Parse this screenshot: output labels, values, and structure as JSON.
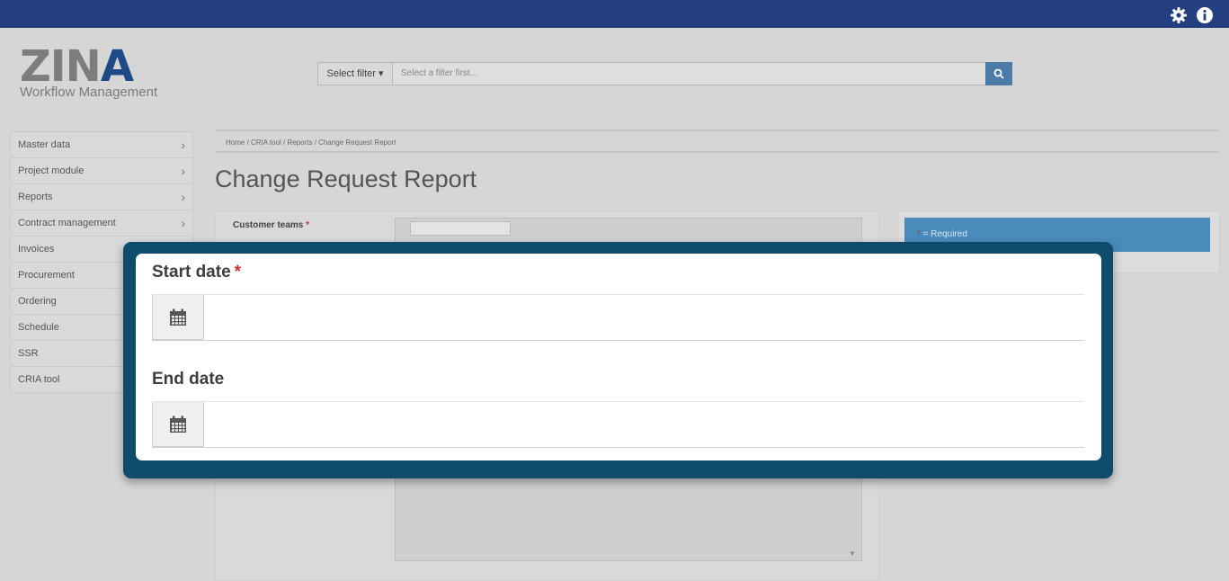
{
  "header": {
    "settings_icon": "gear-icon",
    "info_icon": "info-icon"
  },
  "logo": {
    "brand": "ZINA",
    "subtitle": "Workflow Management"
  },
  "search": {
    "filter_label": "Select filter ▾",
    "placeholder": "Select a filter first...",
    "button_icon": "search-icon"
  },
  "sidebar": {
    "items": [
      {
        "label": "Master data",
        "has_chevron": true
      },
      {
        "label": "Project module",
        "has_chevron": true
      },
      {
        "label": "Reports",
        "has_chevron": true
      },
      {
        "label": "Contract management",
        "has_chevron": true
      },
      {
        "label": "Invoices",
        "has_chevron": false
      },
      {
        "label": "Procurement",
        "has_chevron": false
      },
      {
        "label": "Ordering",
        "has_chevron": false
      },
      {
        "label": "Schedule",
        "has_chevron": false
      },
      {
        "label": "SSR",
        "has_chevron": false
      },
      {
        "label": "CRIA tool",
        "has_chevron": false
      }
    ]
  },
  "breadcrumb": {
    "text": "Home  /  CRIA tool  /  Reports  /  Change Request Report"
  },
  "page": {
    "title": "Change Request Report"
  },
  "form": {
    "customer_teams_label": "Customer teams",
    "required_marker": "*"
  },
  "side_panel": {
    "required_marker": "*",
    "required_text": " = Required"
  },
  "modal": {
    "start_date_label": "Start date",
    "start_date_required": "*",
    "start_date_value": "",
    "end_date_label": "End date",
    "end_date_value": "",
    "calendar_icon": "calendar-icon"
  },
  "colors": {
    "topbar": "#243f80",
    "modal_border": "#0f4c6b",
    "required": "#d0302f",
    "search_button": "#4e7aa7",
    "required_bar": "#4a8bbb"
  }
}
